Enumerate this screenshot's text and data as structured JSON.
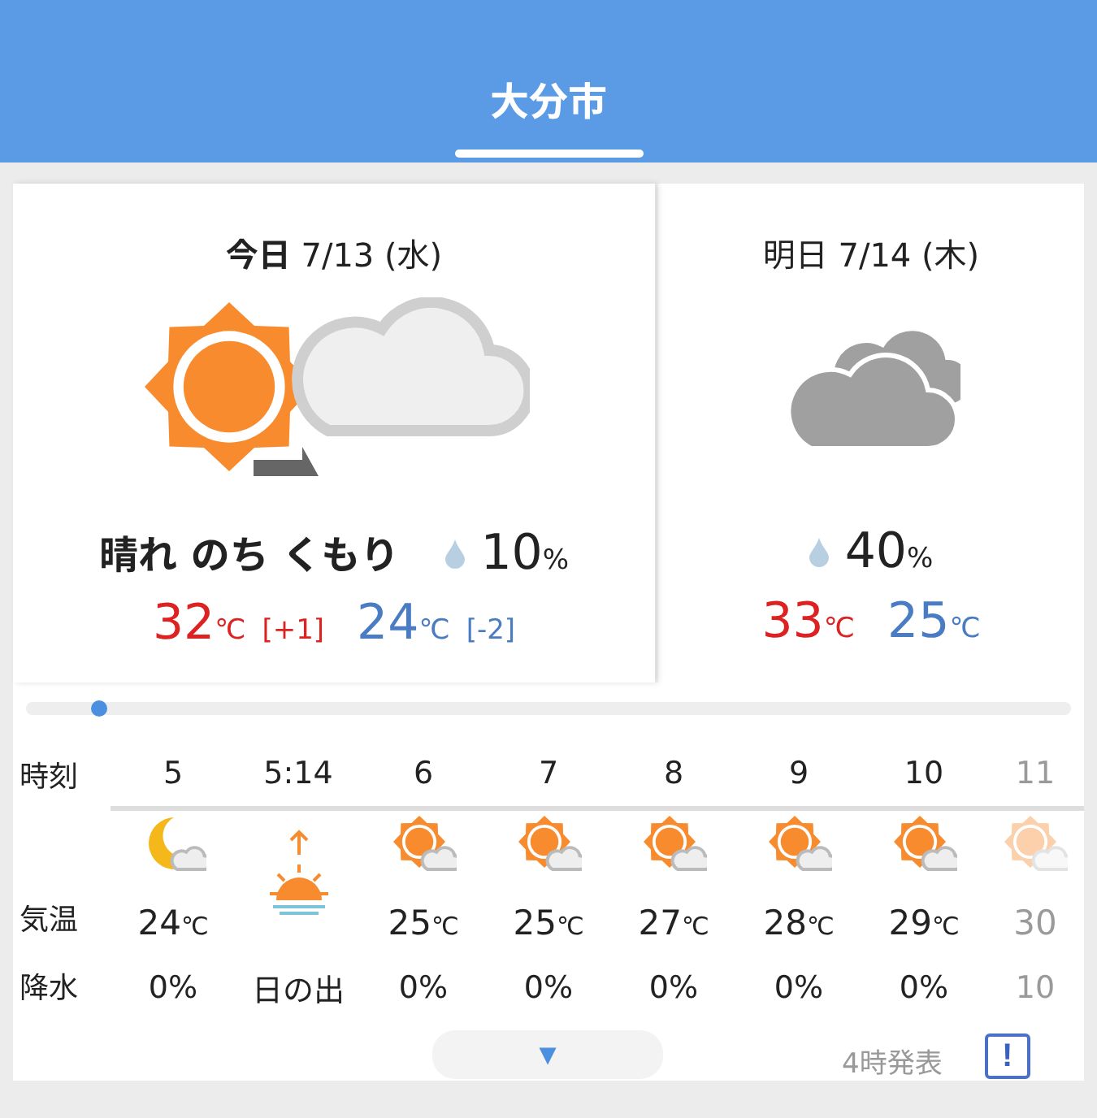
{
  "header": {
    "title": "大分市"
  },
  "days": [
    {
      "label": "今日",
      "date": "7/13 (水)",
      "selected": true,
      "summary": "晴れ のち くもり",
      "rain": "10",
      "rain_unit": "%",
      "high": "32",
      "high_unit": "℃",
      "high_diff": "[+1]",
      "low": "24",
      "low_unit": "℃",
      "low_diff": "[-2]"
    },
    {
      "label": "明日",
      "date": "7/14 (木)",
      "selected": false,
      "rain": "40",
      "rain_unit": "%",
      "high": "33",
      "high_unit": "℃",
      "low": "25",
      "low_unit": "℃"
    }
  ],
  "timeline": {
    "level": 0.07
  },
  "hourly": {
    "row_labels": [
      "時刻",
      "気温",
      "降水"
    ],
    "columns": [
      {
        "kind": "hour",
        "time": "5",
        "temp": "24",
        "unit": "℃",
        "rain": "0%",
        "faded": false
      },
      {
        "kind": "sunrise",
        "time": "5:14",
        "label": "日の出",
        "faded": false
      },
      {
        "kind": "hour",
        "time": "6",
        "temp": "25",
        "unit": "℃",
        "rain": "0%",
        "faded": false
      },
      {
        "kind": "hour",
        "time": "7",
        "temp": "25",
        "unit": "℃",
        "rain": "0%",
        "faded": false
      },
      {
        "kind": "hour",
        "time": "8",
        "temp": "27",
        "unit": "℃",
        "rain": "0%",
        "faded": false
      },
      {
        "kind": "hour",
        "time": "9",
        "temp": "28",
        "unit": "℃",
        "rain": "0%",
        "faded": false
      },
      {
        "kind": "hour",
        "time": "10",
        "temp": "29",
        "unit": "℃",
        "rain": "0%",
        "faded": false
      },
      {
        "kind": "hour",
        "time": "11",
        "temp": "30",
        "rain": "10",
        "faded": true
      }
    ]
  },
  "footer": {
    "expand": "▼",
    "issued": "4時発表",
    "notice": "!"
  }
}
